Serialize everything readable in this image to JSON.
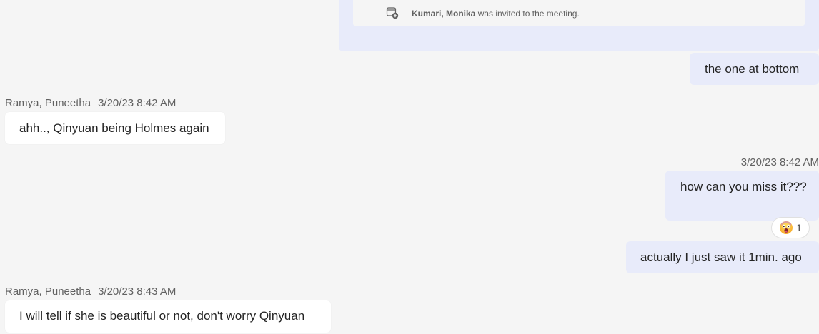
{
  "meeting_card": {
    "invitee": "Kumari, Monika",
    "action": "was invited to the meeting."
  },
  "messages": [
    {
      "id": "m1",
      "text": "the one at bottom"
    },
    {
      "id": "m2",
      "sender": "Ramya, Puneetha",
      "time": "3/20/23 8:42 AM",
      "text": "ahh.., Qinyuan being Holmes again"
    },
    {
      "id": "m3",
      "time": "3/20/23 8:42 AM",
      "text": "how can you miss it???"
    },
    {
      "id": "m4",
      "text": "actually I just saw it 1min. ago"
    },
    {
      "id": "m5",
      "sender": "Ramya, Puneetha",
      "time": "3/20/23 8:43 AM",
      "text": "I will tell if she is beautiful or not, don't worry Qinyuan"
    }
  ],
  "reaction": {
    "icon": "surprised-emoji-icon",
    "count": "1"
  },
  "colors": {
    "background": "#f5f5f5",
    "own_bubble": "#e8ebfa",
    "other_bubble": "#ffffff",
    "meta_text": "#616161"
  }
}
